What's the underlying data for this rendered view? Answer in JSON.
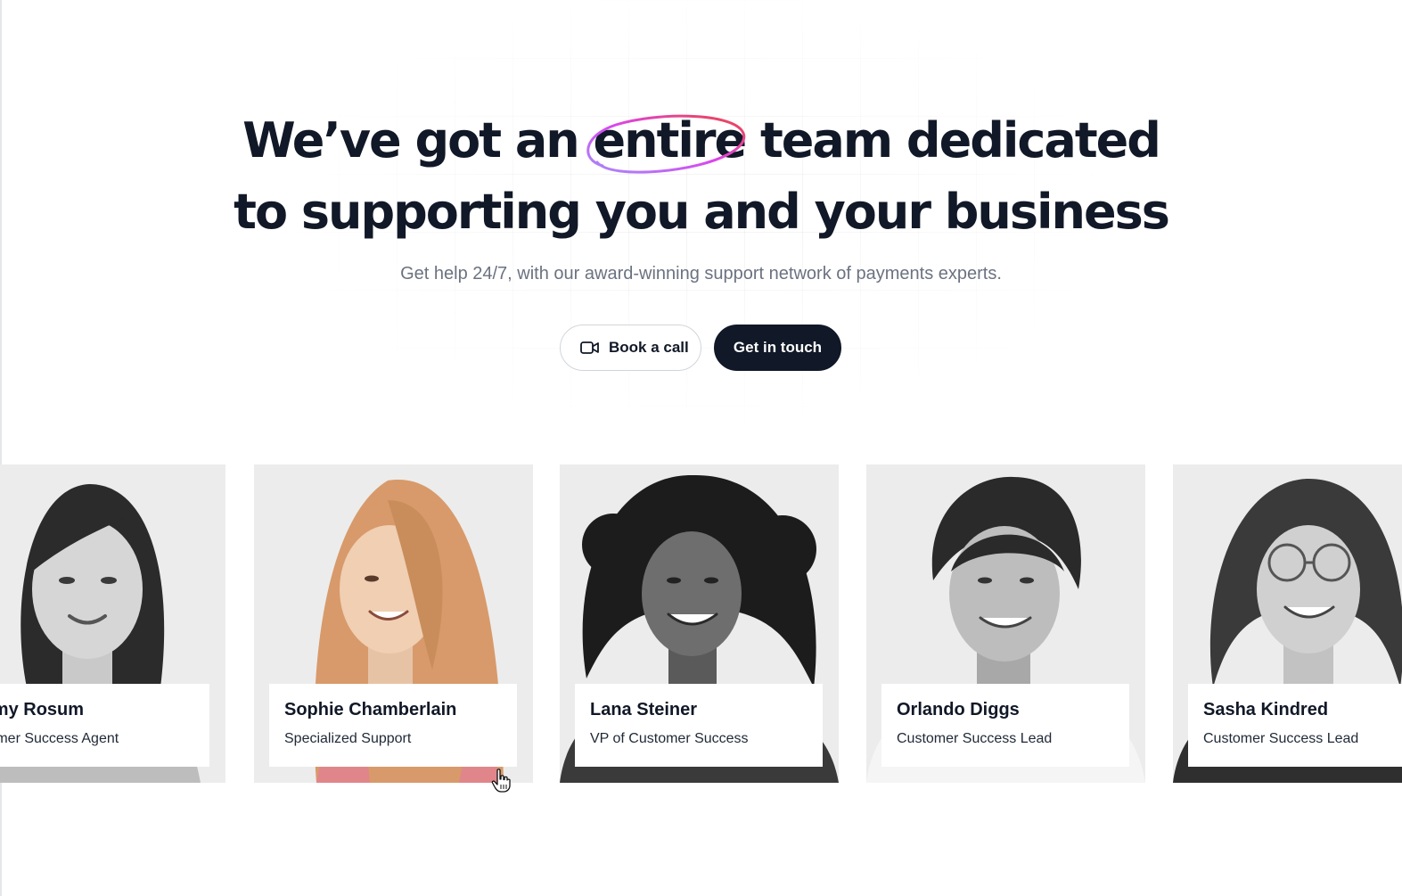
{
  "hero": {
    "headline_part1": "We’ve got an ",
    "headline_highlight": "entire",
    "headline_part2": " team dedicated",
    "headline_line2": "to supporting you and your business",
    "subtitle": "Get help 24/7, with our award-winning support network of payments experts."
  },
  "actions": {
    "book_call_label": "Book a call",
    "book_call_icon": "video-camera-icon",
    "get_in_touch_label": "Get in touch"
  },
  "colors": {
    "primary_dark": "#111827",
    "card_bg": "#ececec",
    "scribble_start": "#a78bfa",
    "scribble_mid": "#d946ef",
    "scribble_end": "#ef4444"
  },
  "team": [
    {
      "name": "mmy Rosum",
      "role": "stomer Success Agent"
    },
    {
      "name": "Sophie Chamberlain",
      "role": "Specialized Support"
    },
    {
      "name": "Lana Steiner",
      "role": "VP of Customer Success"
    },
    {
      "name": "Orlando Diggs",
      "role": "Customer Success Lead"
    },
    {
      "name": "Sasha Kindred",
      "role": "Customer Success Lead"
    }
  ]
}
